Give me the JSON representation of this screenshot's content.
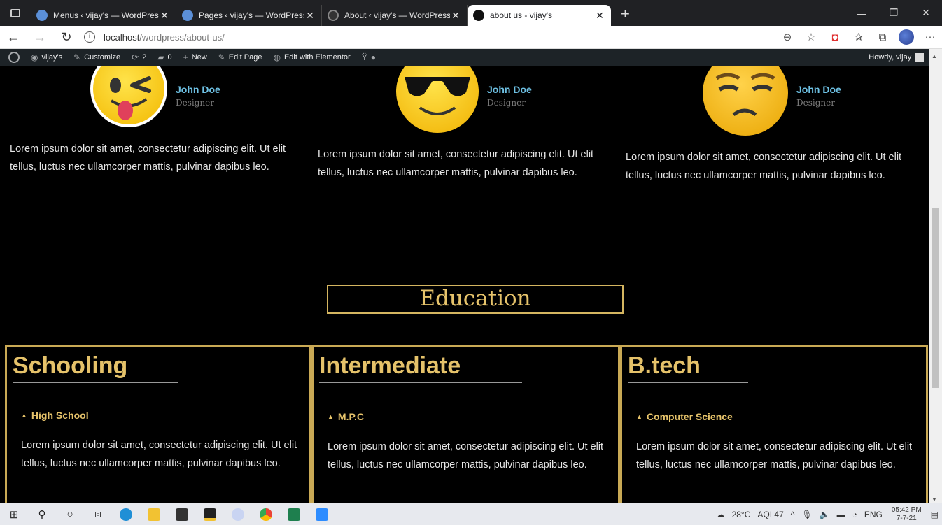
{
  "browser": {
    "tabs": [
      {
        "title": "Menus ‹ vijay's — WordPress"
      },
      {
        "title": "Pages ‹ vijay's — WordPress"
      },
      {
        "title": "About ‹ vijay's — WordPress"
      },
      {
        "title": "about us - vijay's"
      }
    ],
    "url_host": "localhost",
    "url_path": "/wordpress/about-us/"
  },
  "wpbar": {
    "site": "vijay's",
    "customize": "Customize",
    "updates": "2",
    "comments": "0",
    "new": "New",
    "edit_page": "Edit Page",
    "edit_elementor": "Edit with Elementor",
    "howdy": "Howdy, vijay"
  },
  "team": [
    {
      "name": "John Doe",
      "role": "Designer",
      "bio": "Lorem ipsum dolor sit amet, consectetur adipiscing elit. Ut elit tellus, luctus nec ullamcorper mattis, pulvinar dapibus leo."
    },
    {
      "name": "John Doe",
      "role": "Designer",
      "bio": "Lorem ipsum dolor sit amet, consectetur adipiscing elit. Ut elit tellus, luctus nec ullamcorper mattis, pulvinar dapibus leo."
    },
    {
      "name": "John Doe",
      "role": "Designer",
      "bio": "Lorem ipsum dolor sit amet, consectetur adipiscing elit. Ut elit tellus, luctus nec ullamcorper mattis, pulvinar dapibus leo."
    }
  ],
  "education": {
    "heading": "Education",
    "columns": [
      {
        "title": "Schooling",
        "sub": "High School",
        "text": "Lorem ipsum dolor sit amet, consectetur adipiscing elit. Ut elit tellus, luctus nec ullamcorper mattis, pulvinar dapibus leo."
      },
      {
        "title": "Intermediate",
        "sub": "M.P.C",
        "text": "Lorem ipsum dolor sit amet, consectetur adipiscing elit. Ut elit tellus, luctus nec ullamcorper mattis, pulvinar dapibus leo."
      },
      {
        "title": "B.tech",
        "sub": "Computer Science",
        "text": "Lorem ipsum dolor sit amet, consectetur adipiscing elit. Ut elit tellus, luctus nec ullamcorper mattis, pulvinar dapibus leo."
      }
    ]
  },
  "taskbar": {
    "weather": "28°C",
    "aqi": "AQI 47",
    "lang": "ENG",
    "time": "05:42 PM",
    "date": "7-7-21"
  },
  "colors": {
    "accent_gold": "#e5c26a",
    "name_blue": "#6ec1e4"
  }
}
